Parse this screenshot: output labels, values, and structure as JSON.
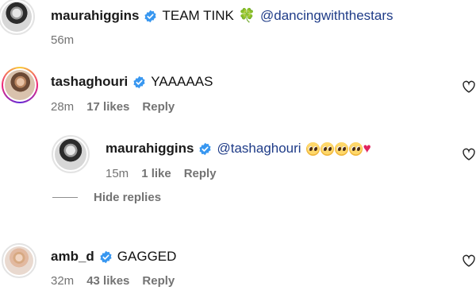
{
  "comments": [
    {
      "username": "maurahiggins",
      "text": "TEAM TINK",
      "clover": "🍀",
      "mention": "@dancingwiththestars",
      "time": "56m"
    },
    {
      "username": "tashaghouri",
      "text": "YAAAAAS",
      "time": "28m",
      "likes": "17 likes",
      "reply": "Reply"
    },
    {
      "username": "maurahiggins",
      "mention": "@tashaghouri",
      "emojis": [
        "🥺",
        "🥺",
        "🥺",
        "🥺"
      ],
      "heart": "❤️",
      "time": "15m",
      "likes": "1 like",
      "reply": "Reply"
    },
    {
      "username": "amb_d",
      "text": "GAGGED",
      "time": "32m",
      "likes": "43 likes",
      "reply": "Reply"
    }
  ],
  "hide_replies": "Hide replies",
  "colors": {
    "verified_blue": "#3897f0",
    "meta_gray": "#737373",
    "mention_blue": "#1f3c88"
  },
  "icons": {
    "verified": "verified-badge-icon",
    "like": "heart-outline-icon"
  }
}
